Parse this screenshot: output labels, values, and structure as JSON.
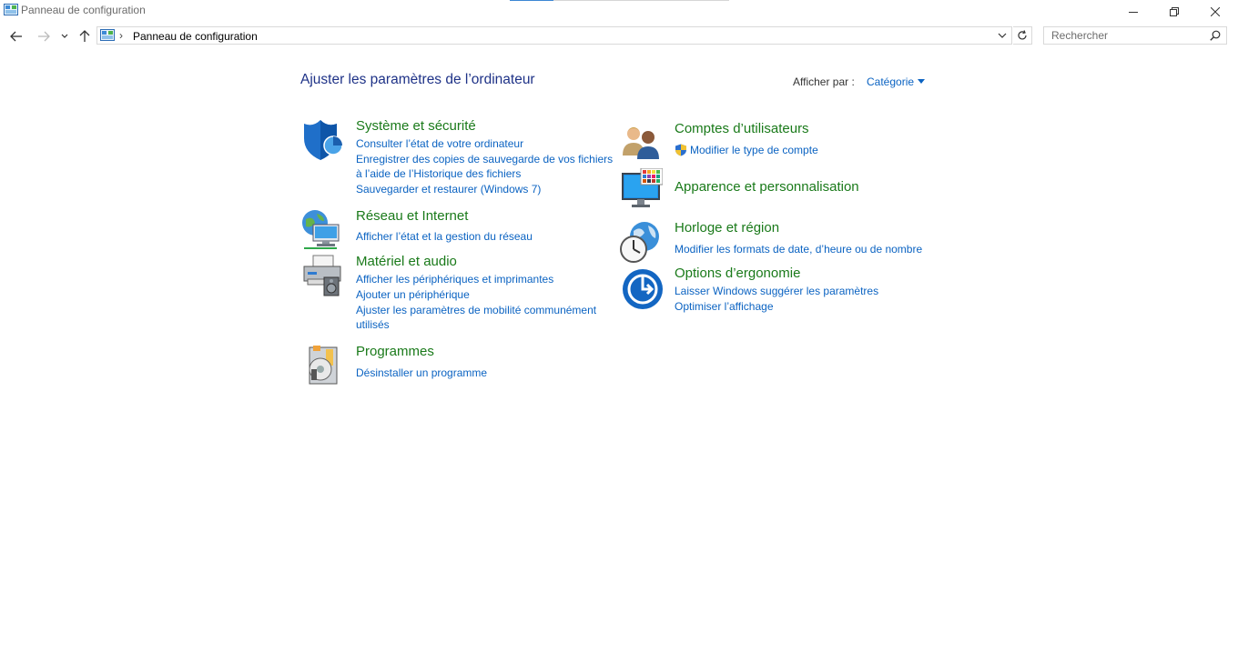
{
  "window": {
    "title": "Panneau de configuration"
  },
  "nav": {
    "address": "Panneau de configuration",
    "search_placeholder": "Rechercher"
  },
  "content": {
    "page_title": "Ajuster les paramètres de l’ordinateur",
    "view_by_label": "Afficher par :",
    "view_by_value": "Catégorie"
  },
  "categories_left": [
    {
      "title": "Système et sécurité",
      "icon": "shield-icon",
      "links": [
        "Consulter l’état de votre ordinateur",
        "Enregistrer des copies de sauvegarde de vos fichiers à l’aide de l’Historique des fichiers",
        "Sauvegarder et restaurer (Windows 7)"
      ]
    },
    {
      "title": "Réseau et Internet",
      "icon": "network-icon",
      "links": [
        "Afficher l’état et la gestion du réseau"
      ]
    },
    {
      "title": "Matériel et audio",
      "icon": "printer-speaker-icon",
      "links": [
        "Afficher les périphériques et imprimantes",
        "Ajouter un périphérique",
        "Ajuster les paramètres de mobilité communément utilisés"
      ]
    },
    {
      "title": "Programmes",
      "icon": "programs-icon",
      "links": [
        "Désinstaller un programme"
      ]
    }
  ],
  "categories_right": [
    {
      "title": "Comptes d’utilisateurs",
      "icon": "users-icon",
      "links": [
        "Modifier le type de compte"
      ]
    },
    {
      "title": "Apparence et personnalisation",
      "icon": "appearance-icon",
      "links": []
    },
    {
      "title": "Horloge et région",
      "icon": "clock-globe-icon",
      "links": [
        "Modifier les formats de date, d’heure ou de nombre"
      ]
    },
    {
      "title": "Options d’ergonomie",
      "icon": "ease-of-access-icon",
      "links": [
        "Laisser Windows suggérer les paramètres",
        "Optimiser l’affichage"
      ]
    }
  ],
  "colors": {
    "link": "#0b63c2",
    "category_title": "#1a7a1a",
    "page_title": "#1e3287"
  }
}
